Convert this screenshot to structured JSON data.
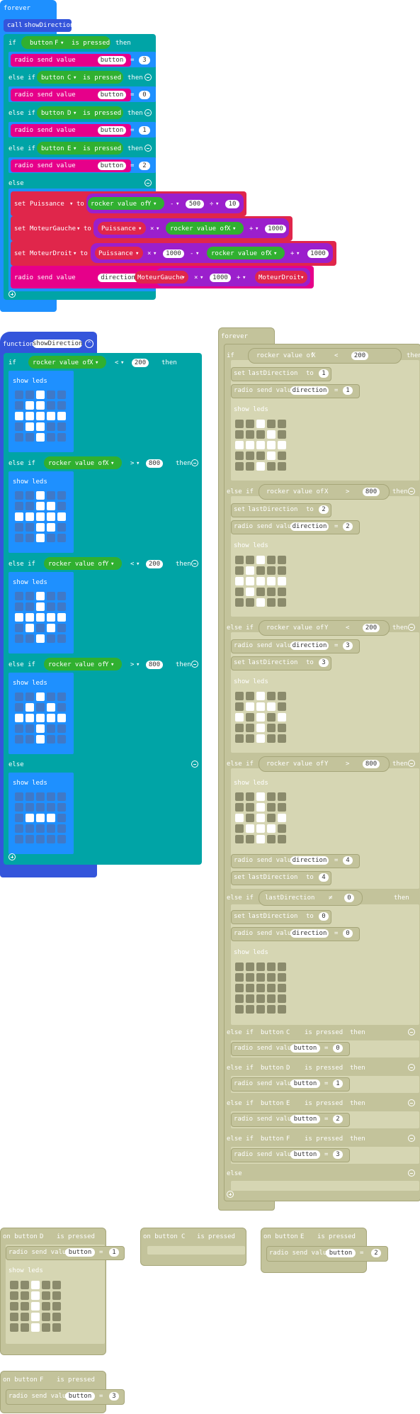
{
  "colors": {
    "loops": "#1e90ff",
    "logic": "#00a4a6",
    "input": "#30b030",
    "radio": "#e6008a",
    "variables": "#e0264b",
    "math": "#9b1fcc",
    "functions": "#3455db",
    "disabled": "#c3c39b"
  },
  "kw": {
    "forever": "forever",
    "if": "if",
    "else_if": "else if",
    "else": "else",
    "then": "then",
    "set": "set",
    "to": "to",
    "function": "function",
    "call": "call",
    "show_leds": "show leds",
    "radio_send": "radio send value",
    "button": "button",
    "is_pressed": "is pressed",
    "pressed": "pressed",
    "on_button": "on button",
    "is": "is",
    "rocker": "rocker value of"
  },
  "ops": {
    "eq": "=",
    "lt": "<",
    "gt": ">",
    "minus": "-",
    "plus": "+",
    "times": "×",
    "div": "÷"
  },
  "names": {
    "showDirection": "showDirection",
    "Puissance": "Puissance",
    "MoteurGauche": "MoteurGauche",
    "MoteurDroit": "MoteurDroit",
    "directionXY": "directionXY",
    "lastDirection": "lastDirection",
    "direction": "direction",
    "button": "button"
  },
  "axes": {
    "x": "X",
    "y": "Y"
  },
  "buttons": {
    "F": "F",
    "C": "C",
    "D": "D",
    "E": "E"
  },
  "nums": {
    "n0": "0",
    "n1": "1",
    "n2": "2",
    "n3": "3",
    "n4": "4",
    "n10": "10",
    "n200": "200",
    "n500": "500",
    "n800": "800",
    "n1000": "1000"
  },
  "leds": {
    "up": [
      [
        0,
        0,
        1,
        0,
        0
      ],
      [
        0,
        1,
        0,
        1,
        0
      ],
      [
        1,
        1,
        1,
        1,
        1
      ],
      [
        0,
        0,
        1,
        0,
        0
      ],
      [
        0,
        0,
        1,
        0,
        0
      ]
    ],
    "down": [
      [
        0,
        0,
        1,
        0,
        0
      ],
      [
        0,
        0,
        1,
        0,
        0
      ],
      [
        1,
        1,
        1,
        1,
        1
      ],
      [
        0,
        1,
        0,
        1,
        0
      ],
      [
        0,
        0,
        1,
        0,
        0
      ]
    ],
    "left": [
      [
        0,
        0,
        1,
        0,
        0
      ],
      [
        0,
        1,
        1,
        0,
        0
      ],
      [
        1,
        1,
        1,
        1,
        1
      ],
      [
        0,
        1,
        1,
        0,
        0
      ],
      [
        0,
        0,
        1,
        0,
        0
      ]
    ],
    "right": [
      [
        0,
        0,
        1,
        0,
        0
      ],
      [
        0,
        0,
        1,
        1,
        0
      ],
      [
        1,
        1,
        1,
        1,
        1
      ],
      [
        0,
        0,
        1,
        1,
        0
      ],
      [
        0,
        0,
        1,
        0,
        0
      ]
    ],
    "stop": [
      [
        0,
        0,
        0,
        0,
        0
      ],
      [
        0,
        0,
        0,
        0,
        0
      ],
      [
        0,
        1,
        1,
        1,
        0
      ],
      [
        0,
        0,
        0,
        0,
        0
      ],
      [
        0,
        0,
        0,
        0,
        0
      ]
    ],
    "blank": [
      [
        0,
        0,
        0,
        0,
        0
      ],
      [
        0,
        0,
        0,
        0,
        0
      ],
      [
        0,
        0,
        0,
        0,
        0
      ],
      [
        0,
        0,
        0,
        0,
        0
      ],
      [
        0,
        0,
        0,
        0,
        0
      ]
    ],
    "d_right": [
      [
        0,
        0,
        1,
        0,
        0
      ],
      [
        0,
        0,
        0,
        1,
        0
      ],
      [
        1,
        1,
        1,
        1,
        1
      ],
      [
        0,
        0,
        0,
        1,
        0
      ],
      [
        0,
        0,
        1,
        0,
        0
      ]
    ],
    "d_left": [
      [
        0,
        0,
        1,
        0,
        0
      ],
      [
        0,
        1,
        0,
        0,
        0
      ],
      [
        1,
        1,
        1,
        1,
        1
      ],
      [
        0,
        1,
        0,
        0,
        0
      ],
      [
        0,
        0,
        1,
        0,
        0
      ]
    ],
    "d_up": [
      [
        0,
        0,
        1,
        0,
        0
      ],
      [
        0,
        1,
        1,
        1,
        0
      ],
      [
        1,
        0,
        1,
        0,
        1
      ],
      [
        0,
        0,
        1,
        0,
        0
      ],
      [
        0,
        0,
        1,
        0,
        0
      ]
    ],
    "d_down": [
      [
        0,
        0,
        1,
        0,
        0
      ],
      [
        0,
        0,
        1,
        0,
        0
      ],
      [
        1,
        0,
        1,
        0,
        1
      ],
      [
        0,
        1,
        1,
        1,
        0
      ],
      [
        0,
        0,
        1,
        0,
        0
      ]
    ],
    "bD": [
      [
        0,
        0,
        1,
        0,
        0
      ],
      [
        0,
        0,
        1,
        0,
        0
      ],
      [
        0,
        0,
        1,
        0,
        0
      ],
      [
        0,
        0,
        1,
        0,
        0
      ],
      [
        0,
        0,
        1,
        0,
        0
      ]
    ]
  }
}
